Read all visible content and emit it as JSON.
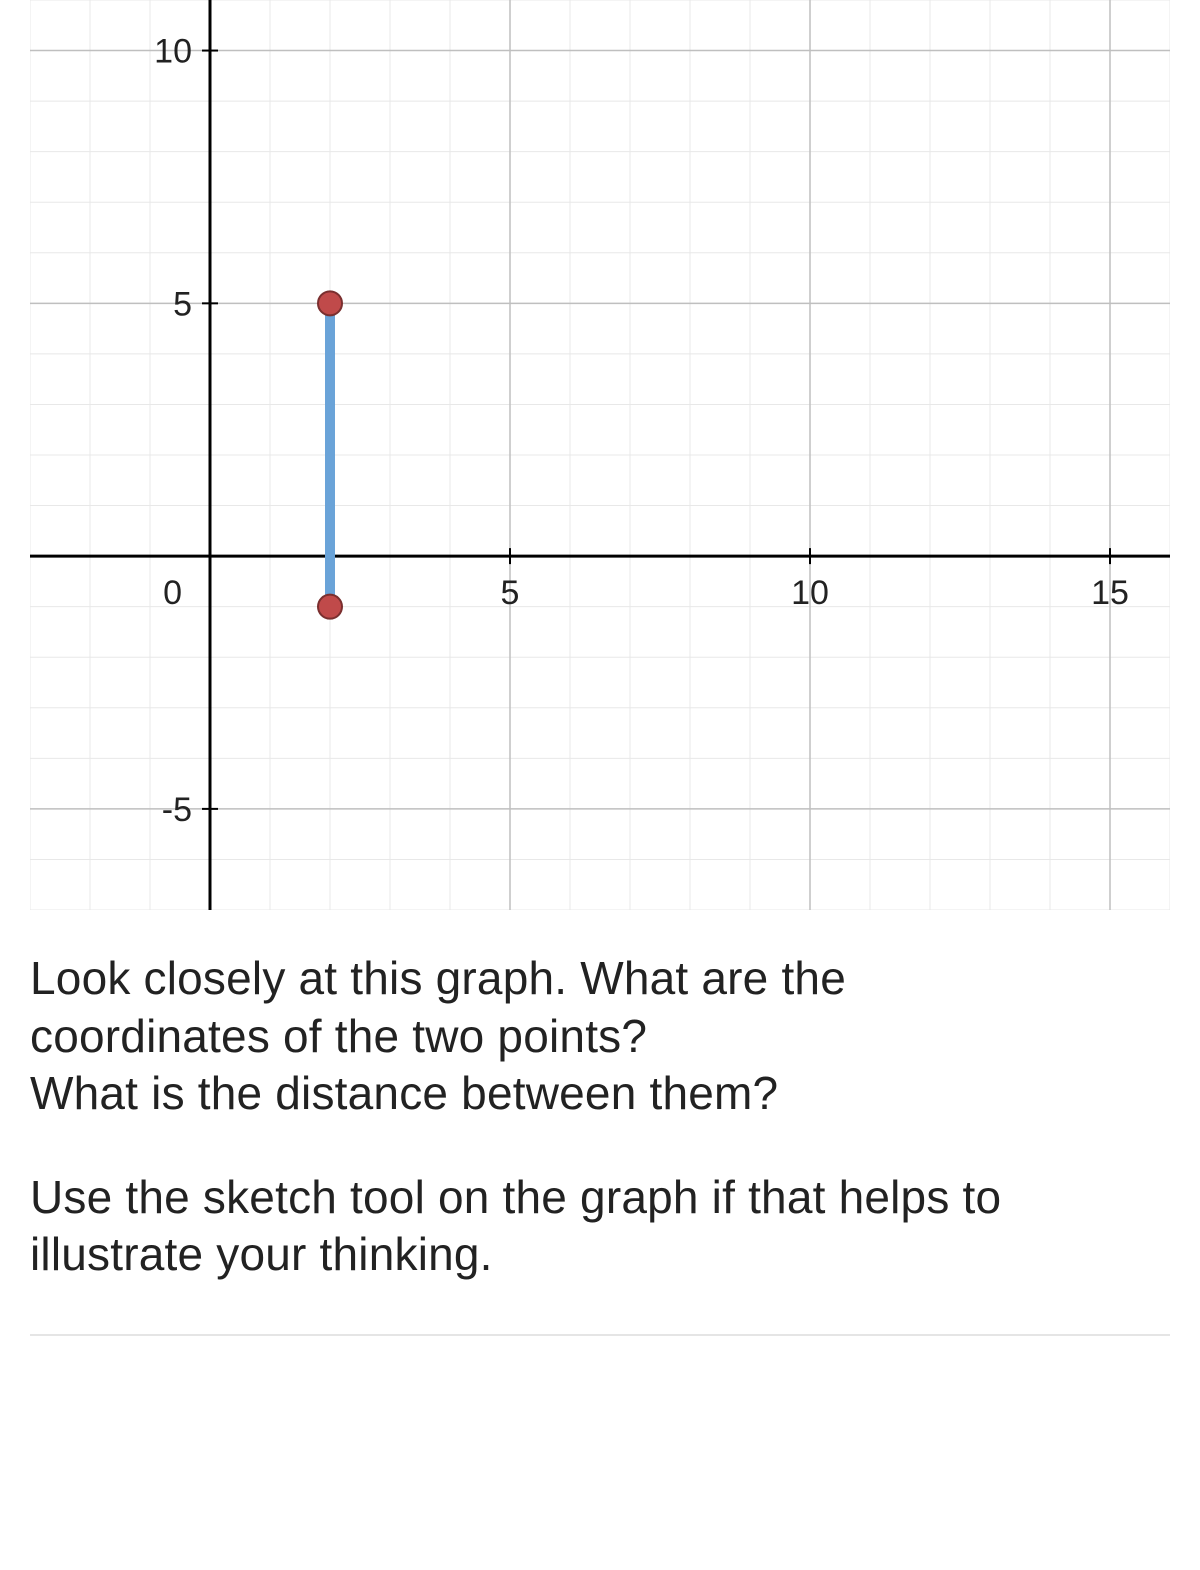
{
  "chart_data": {
    "type": "scatter",
    "xlim": [
      -3,
      16
    ],
    "ylim": [
      -7,
      11
    ],
    "x_ticks": [
      0,
      5,
      10,
      15
    ],
    "y_ticks": [
      -5,
      0,
      5,
      10
    ],
    "x_tick_labels": [
      "0",
      "5",
      "10",
      "15"
    ],
    "y_tick_labels": [
      "-5",
      "",
      "5",
      "10"
    ],
    "minor_grid_step": 1,
    "points": [
      {
        "x": 2,
        "y": 5
      },
      {
        "x": 2,
        "y": -1
      }
    ],
    "segment": {
      "x1": 2,
      "y1": 5,
      "x2": 2,
      "y2": -1
    },
    "colors": {
      "minor_grid": "#e8e8e8",
      "major_grid": "#bfbfbf",
      "axis": "#000000",
      "segment": "#6aa3d8",
      "point_fill": "#c04a4a",
      "point_stroke": "#7a2f2f"
    }
  },
  "question": {
    "para1_line1": "Look closely at this graph. What are the",
    "para1_line2": "coordinates of the two points?",
    "para1_line3": "What is the distance between them?",
    "para2_line1": "Use the sketch tool on the graph if that helps to",
    "para2_line2": "illustrate your thinking."
  }
}
